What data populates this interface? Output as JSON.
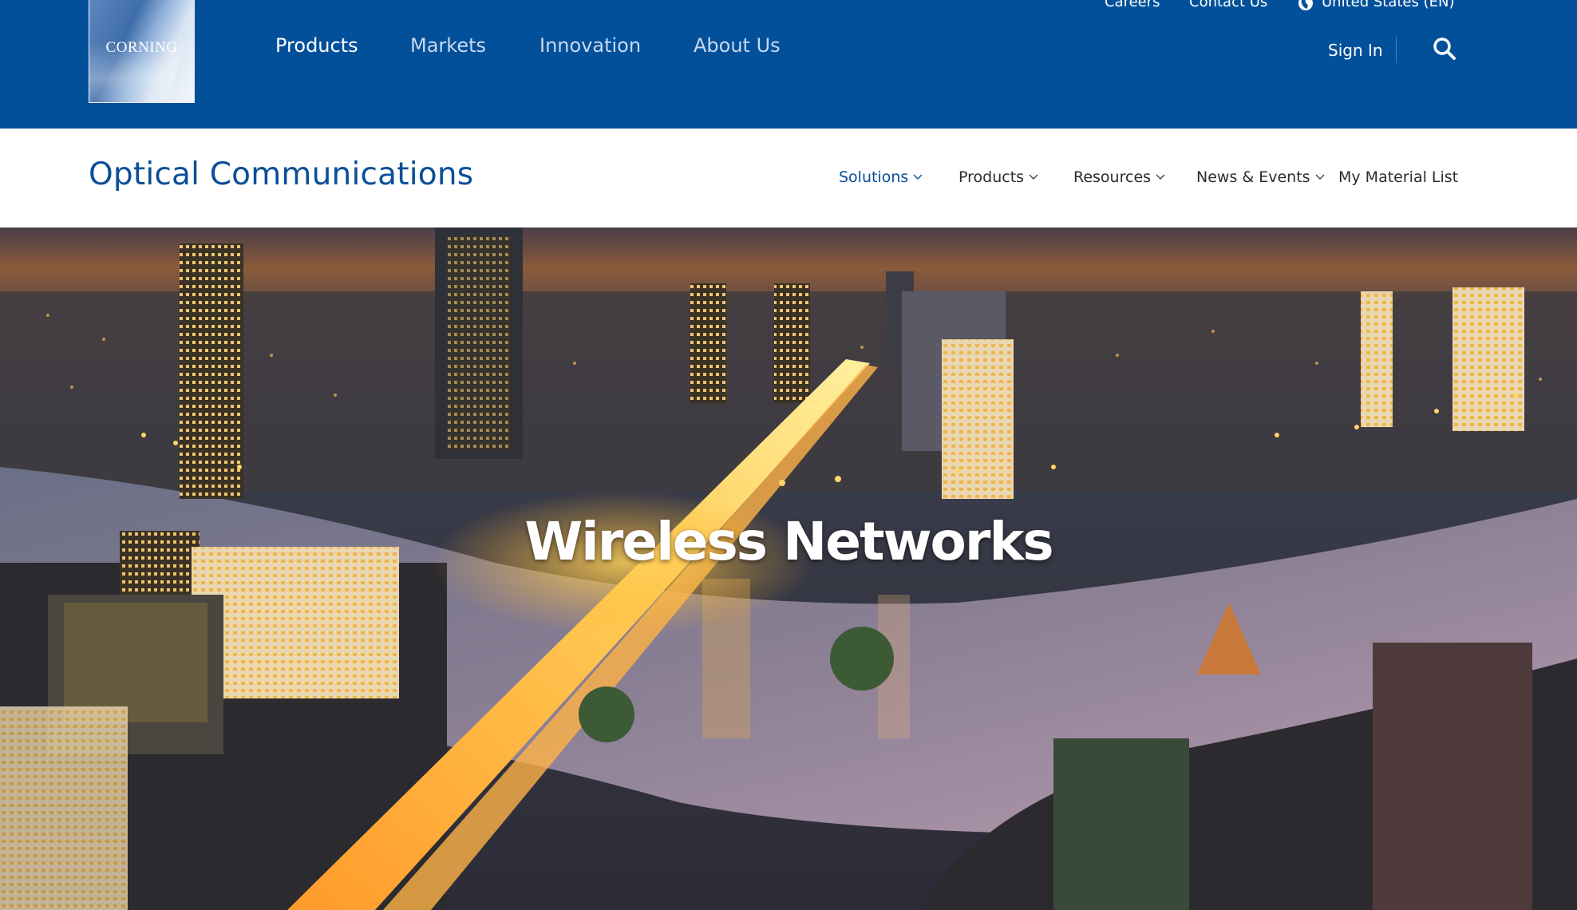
{
  "header": {
    "logo_text": "CORNING",
    "nav": [
      {
        "label": "Products",
        "active": true
      },
      {
        "label": "Markets",
        "active": false
      },
      {
        "label": "Innovation",
        "active": false
      },
      {
        "label": "About Us",
        "active": false
      }
    ],
    "utility": {
      "careers": "Careers",
      "contact": "Contact Us",
      "region": "United States (EN)"
    },
    "sign_in": "Sign In",
    "search_icon": "search-icon",
    "colors": {
      "primary": "#03509a",
      "accent": "#0a4f98"
    }
  },
  "subheader": {
    "title": "Optical Communications",
    "nav": [
      {
        "label": "Solutions",
        "has_dropdown": true,
        "active": true
      },
      {
        "label": "Products",
        "has_dropdown": true,
        "active": false
      },
      {
        "label": "Resources",
        "has_dropdown": true,
        "active": false
      },
      {
        "label": "News & Events",
        "has_dropdown": true,
        "active": false
      },
      {
        "label": "My Material List",
        "has_dropdown": false,
        "active": false
      }
    ]
  },
  "hero": {
    "title": "Wireless Networks"
  }
}
